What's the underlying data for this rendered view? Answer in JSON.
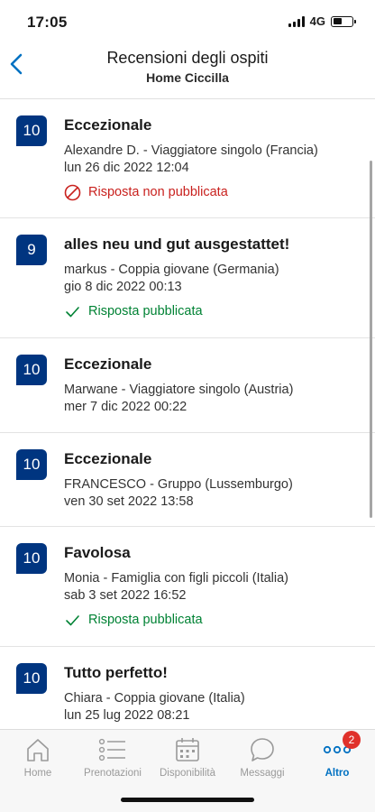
{
  "status_bar": {
    "time": "17:05",
    "network": "4G"
  },
  "header": {
    "title": "Recensioni degli ospiti",
    "subtitle": "Home Ciccilla"
  },
  "reviews": [
    {
      "score": "10",
      "title": "Eccezionale",
      "author": "Alexandre D. - Viaggiatore singolo (Francia)",
      "date": "lun 26 dic 2022 12:04",
      "reply": "Risposta non pubblicata",
      "reply_state": "unpublished"
    },
    {
      "score": "9",
      "title": "alles neu und gut ausgestattet!",
      "author": "markus - Coppia giovane (Germania)",
      "date": "gio 8 dic 2022 00:13",
      "reply": "Risposta pubblicata",
      "reply_state": "published"
    },
    {
      "score": "10",
      "title": "Eccezionale",
      "author": "Marwane - Viaggiatore singolo (Austria)",
      "date": "mer 7 dic 2022 00:22",
      "reply": "",
      "reply_state": "none"
    },
    {
      "score": "10",
      "title": "Eccezionale",
      "author": "FRANCESCO - Gruppo (Lussemburgo)",
      "date": "ven 30 set 2022 13:58",
      "reply": "",
      "reply_state": "none"
    },
    {
      "score": "10",
      "title": "Favolosa",
      "author": "Monia - Famiglia con figli piccoli (Italia)",
      "date": "sab 3 set 2022 16:52",
      "reply": "Risposta pubblicata",
      "reply_state": "published"
    },
    {
      "score": "10",
      "title": "Tutto perfetto!",
      "author": "Chiara - Coppia giovane (Italia)",
      "date": "lun 25 lug 2022 08:21",
      "reply": "",
      "reply_state": "none"
    }
  ],
  "tab_bar": {
    "home": "Home",
    "reservations": "Prenotazioni",
    "availability": "Disponibilità",
    "messages": "Messaggi",
    "more": "Altro",
    "more_badge": "2"
  },
  "colors": {
    "score_badge": "#003580",
    "accent": "#0071c2",
    "published": "#008234",
    "unpublished": "#c9211e",
    "notification": "#e0312b"
  }
}
